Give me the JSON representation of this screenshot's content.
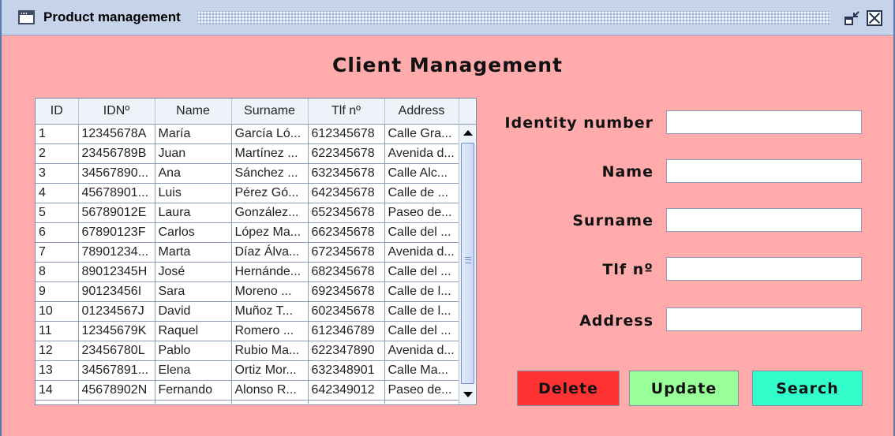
{
  "window": {
    "title": "Product management",
    "accent": "#c6d3ea",
    "background": "#ffabab"
  },
  "heading": "Client Management",
  "table": {
    "columns": [
      "ID",
      "IDNº",
      "Name",
      "Surname",
      "Tlf nº",
      "Address"
    ],
    "rows": [
      [
        "1",
        "12345678A",
        "María",
        "García Ló...",
        "612345678",
        "Calle Gra..."
      ],
      [
        "2",
        "23456789B",
        "Juan",
        "Martínez ...",
        "622345678",
        "Avenida d..."
      ],
      [
        "3",
        "34567890...",
        "Ana",
        "Sánchez ...",
        "632345678",
        "Calle Alc..."
      ],
      [
        "4",
        "45678901...",
        "Luis",
        "Pérez Gó...",
        "642345678",
        "Calle de ..."
      ],
      [
        "5",
        "56789012E",
        "Laura",
        "González...",
        "652345678",
        "Paseo de..."
      ],
      [
        "6",
        "67890123F",
        "Carlos",
        "López Ma...",
        "662345678",
        "Calle del ..."
      ],
      [
        "7",
        "78901234...",
        "Marta",
        "Díaz Álva...",
        "672345678",
        "Avenida d..."
      ],
      [
        "8",
        "89012345H",
        "José",
        "Hernánde...",
        "682345678",
        "Calle del ..."
      ],
      [
        "9",
        "90123456I",
        "Sara",
        "Moreno ...",
        "692345678",
        "Calle de l..."
      ],
      [
        "10",
        "01234567J",
        "David",
        "Muñoz T...",
        "602345678",
        "Calle de l..."
      ],
      [
        "11",
        "12345679K",
        "Raquel",
        "Romero ...",
        "612346789",
        "Calle del ..."
      ],
      [
        "12",
        "23456780L",
        "Pablo",
        "Rubio Ma...",
        "622347890",
        "Avenida d..."
      ],
      [
        "13",
        "34567891...",
        "Elena",
        "Ortiz Mor...",
        "632348901",
        "Calle Ma..."
      ],
      [
        "14",
        "45678902N",
        "Fernando",
        "Alonso R...",
        "642349012",
        "Paseo de..."
      ]
    ]
  },
  "form": {
    "identity_label": "Identity number",
    "name_label": "Name",
    "surname_label": "Surname",
    "tlf_label": "Tlf nº",
    "address_label": "Address",
    "identity_value": "",
    "name_value": "",
    "surname_value": "",
    "tlf_value": "",
    "address_value": ""
  },
  "buttons": {
    "delete_label": "Delete",
    "delete_color": "#ff3333",
    "update_label": "Update",
    "update_color": "#99ff99",
    "search_label": "Search",
    "search_color": "#33ffcc"
  },
  "icons": [
    "app-window-icon",
    "restore-icon",
    "close-icon",
    "scroll-up-arrow-icon",
    "scroll-down-arrow-icon"
  ]
}
